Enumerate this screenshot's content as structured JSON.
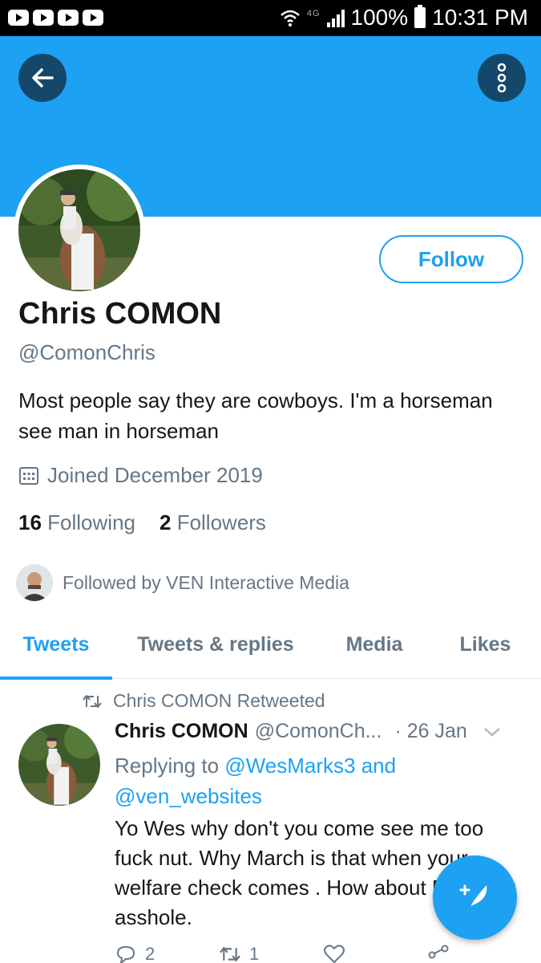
{
  "status_bar": {
    "battery": "100%",
    "time": "10:31 PM",
    "network": "4G"
  },
  "profile": {
    "name": "Chris COMON",
    "handle": "@ComonChris",
    "bio": "Most people say they are cowboys. I'm a horseman see man in horseman",
    "joined": "Joined December 2019",
    "following_count": "16",
    "following_label": "Following",
    "followers_count": "2",
    "followers_label": "Followers",
    "followed_by": "Followed by VEN Interactive Media",
    "follow_button": "Follow"
  },
  "tabs": [
    {
      "label": "Tweets",
      "active": true
    },
    {
      "label": "Tweets & replies",
      "active": false
    },
    {
      "label": "Media",
      "active": false
    },
    {
      "label": "Likes",
      "active": false
    }
  ],
  "tweet": {
    "retweet_label": "Chris COMON Retweeted",
    "author_name": "Chris COMON",
    "author_handle": "@ComonCh...",
    "date": "· 26 Jan",
    "replying_prefix": "Replying to",
    "replying_user1": "@WesMarks3",
    "replying_and": "and",
    "replying_user2": "@ven_websites",
    "text": "Yo Wes why don't you come see me too fuck nut. Why March is that when your welfare check comes . How about February asshole.",
    "reply_count": "2",
    "retweet_count": "1"
  },
  "icons": [
    "back-arrow-icon",
    "more-vertical-icon",
    "calendar-icon",
    "retweet-icon",
    "chevron-down-icon",
    "reply-icon",
    "like-icon",
    "share-icon",
    "compose-icon"
  ],
  "colors": {
    "accent": "#1da1f2",
    "banner": "#1da1f2",
    "button_dark": "#15476b",
    "secondary_text": "#657786"
  }
}
